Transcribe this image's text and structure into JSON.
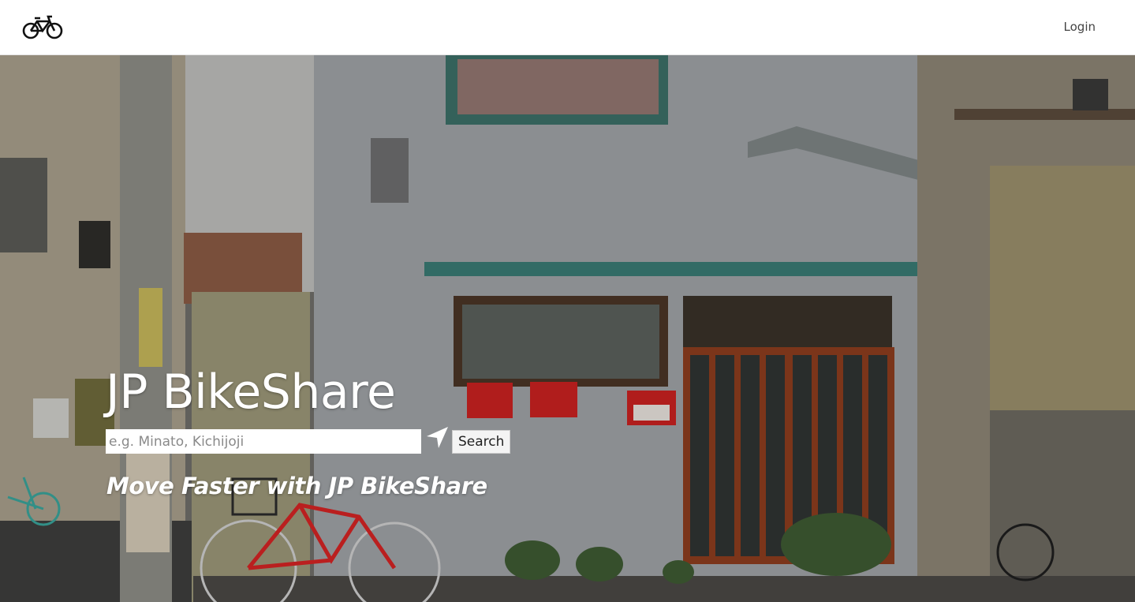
{
  "navbar": {
    "logo_icon": "bicycle-icon",
    "login_label": "Login"
  },
  "hero": {
    "title": "JP BikeShare",
    "search": {
      "placeholder": "e.g. Minato, Kichijoji",
      "value": "",
      "locate_icon": "location-arrow-icon",
      "button_label": "Search"
    },
    "tagline": "Move Faster with JP BikeShare"
  },
  "colors": {
    "hero_text": "#ffffff",
    "bike_red": "#d42424",
    "mailbox_red": "#c92220",
    "door_wood": "#a24a25",
    "awning_teal": "#3f8480"
  }
}
